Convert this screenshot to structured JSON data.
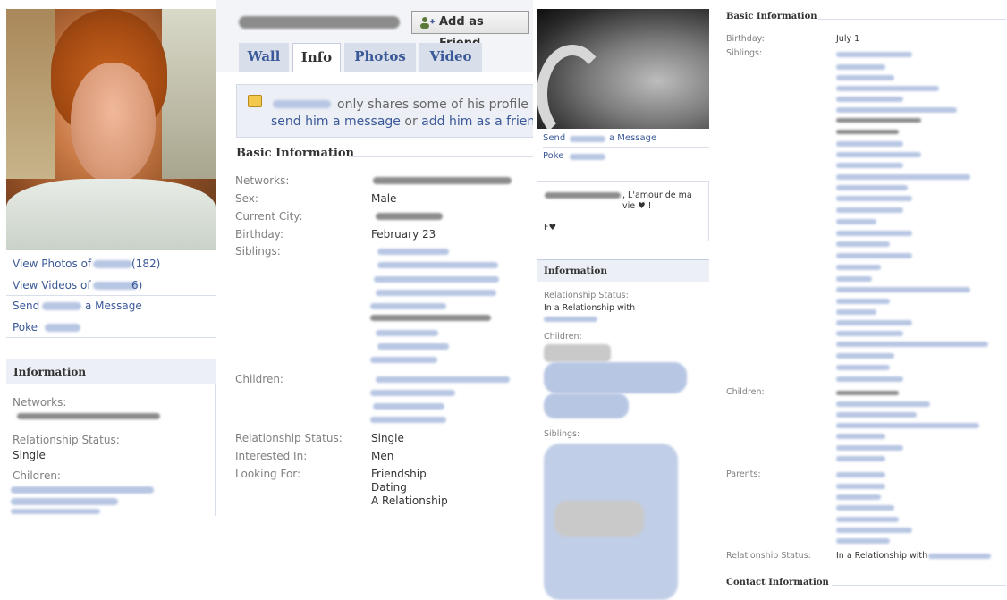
{
  "panel1": {
    "links": [
      {
        "prefix": "View Photos of",
        "suffix": "(182)"
      },
      {
        "prefix": "View Videos of",
        "suffix": "6)"
      },
      {
        "prefix": "Send",
        "suffix": "a Message"
      },
      {
        "prefix": "Poke",
        "suffix": ""
      }
    ],
    "info_heading": "Information",
    "networks_label": "Networks:",
    "relationship_label": "Relationship Status:",
    "relationship_value": "Single",
    "children_label": "Children:"
  },
  "panel2": {
    "add_friend_label": "Add as Friend",
    "tabs": [
      "Wall",
      "Info",
      "Photos",
      "Video"
    ],
    "notice_line1": "only shares some of his profile infor",
    "notice_send": "send him a message",
    "notice_or": "or",
    "notice_add": "add him as a friend",
    "basic_heading": "Basic Information",
    "fields": {
      "networks_label": "Networks:",
      "sex_label": "Sex:",
      "sex_value": "Male",
      "city_label": "Current City:",
      "birthday_label": "Birthday:",
      "birthday_value": "February 23",
      "siblings_label": "Siblings:",
      "children_label": "Children:",
      "relationship_label": "Relationship Status:",
      "relationship_value": "Single",
      "interested_label": "Interested In:",
      "interested_value": "Men",
      "looking_label": "Looking For:",
      "looking_values": [
        "Friendship",
        "Dating",
        "A Relationship"
      ]
    }
  },
  "panel3": {
    "send_prefix": "Send",
    "send_suffix": "a Message",
    "poke_label": "Poke",
    "status_text": ", L'amour de ma vie ♥ !",
    "status_sign": "F♥",
    "info_heading": "Information",
    "relationship_label": "Relationship Status:",
    "relationship_value": "In a Relationship with",
    "children_label": "Children:",
    "siblings_label": "Siblings:"
  },
  "panel4": {
    "basic_heading": "Basic Information",
    "birthday_label": "Birthday:",
    "birthday_value": "July 1",
    "siblings_label": "Siblings:",
    "children_label": "Children:",
    "parents_label": "Parents:",
    "relationship_label": "Relationship Status:",
    "relationship_value": "In a Relationship with",
    "contact_heading": "Contact Information"
  },
  "colors": {
    "link": "#3b5998",
    "label": "#808080",
    "header_bg": "#eceff5",
    "redaction_blue": "#b7c6e3"
  }
}
